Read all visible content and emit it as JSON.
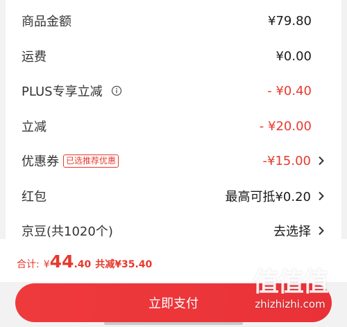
{
  "rows": [
    {
      "label": "商品金额",
      "value": "¥79.80"
    },
    {
      "label": "运费",
      "value": "¥0.00"
    },
    {
      "label": "PLUS专享立减",
      "value": "- ¥0.40"
    },
    {
      "label": "立减",
      "value": "- ¥20.00"
    },
    {
      "label": "优惠券",
      "tag": "已选推荐优惠",
      "value": "-¥15.00"
    },
    {
      "label": "红包",
      "value": "最高可抵¥0.20"
    },
    {
      "label": "京豆(共1020个)",
      "value": "去选择"
    }
  ],
  "summary": {
    "total_label": "合计:",
    "currency": "¥",
    "total_int": "44",
    "total_dec": ".40",
    "reduce_text": "共减¥35.40"
  },
  "pay_button": {
    "label": "立即支付"
  },
  "watermark": {
    "logo": "值值值",
    "url": "zhizhizhi.com"
  },
  "colors": {
    "accent": "#e8392d",
    "button": "#ef3a3c"
  },
  "icons": {
    "info": "info-icon",
    "chevron": "chevron-right-icon"
  }
}
